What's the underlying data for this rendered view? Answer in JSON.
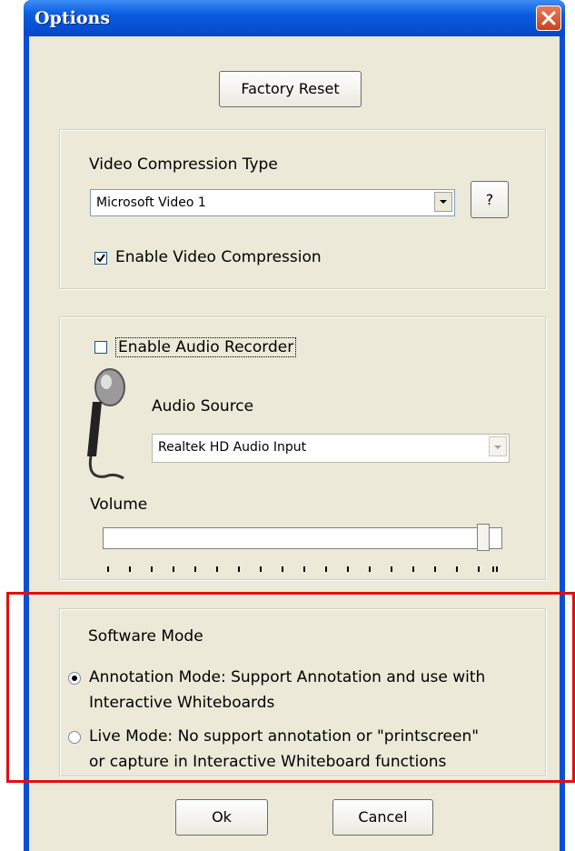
{
  "window": {
    "title": "Options"
  },
  "buttons": {
    "factory_reset": "Factory Reset",
    "help": "?",
    "ok": "Ok",
    "cancel": "Cancel"
  },
  "video": {
    "compression_type_label": "Video Compression Type",
    "compression_type_value": "Microsoft Video 1",
    "enable_compression_label": "Enable Video Compression",
    "enable_compression_checked": true
  },
  "audio": {
    "enable_recorder_label": "Enable Audio Recorder",
    "enable_recorder_checked": false,
    "source_label": "Audio Source",
    "source_value": "Realtek HD Audio Input",
    "volume_label": "Volume",
    "volume_level": 0.97
  },
  "software_mode": {
    "heading": "Software Mode",
    "options": [
      {
        "line1": "Annotation Mode: Support Annotation and use with",
        "line2": "Interactive Whiteboards",
        "selected": true
      },
      {
        "line1": "Live Mode: No support annotation or \"printscreen\"",
        "line2": "or capture in Interactive Whiteboard functions",
        "selected": false
      }
    ]
  },
  "colors": {
    "titlebar": "#0a5be0",
    "dialog_bg": "#ece9d8",
    "highlight": "#e01010"
  },
  "icons": {
    "close": "close-icon",
    "microphone": "microphone-icon",
    "dropdown": "chevron-down-icon"
  }
}
